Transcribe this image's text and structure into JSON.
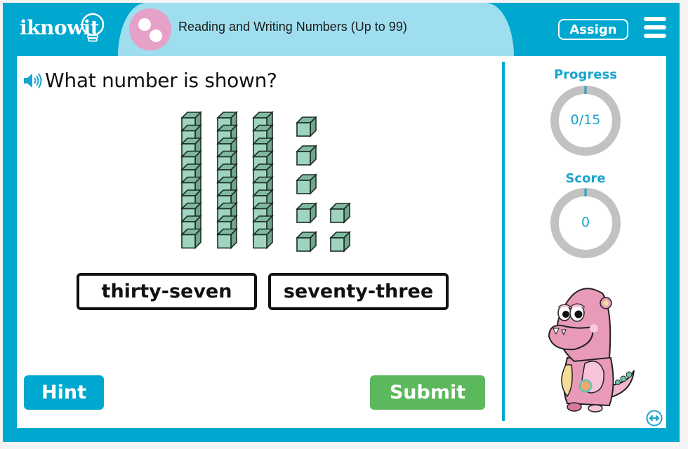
{
  "header": {
    "logo": "iknowit",
    "lesson_title": "Reading and Writing Numbers (Up to 99)",
    "assign_label": "Assign",
    "menu_icon": "hamburger-menu-icon"
  },
  "question": {
    "speaker_icon": "speaker-icon",
    "text": "What number is shown?",
    "base_ten_blocks": {
      "tens_rods": 3,
      "ones_cubes": 7
    }
  },
  "answers": [
    {
      "label": "thirty-seven"
    },
    {
      "label": "seventy-three"
    }
  ],
  "buttons": {
    "hint": "Hint",
    "submit": "Submit"
  },
  "sidebar": {
    "progress": {
      "label": "Progress",
      "value": "0/15",
      "fraction": 0
    },
    "score": {
      "label": "Score",
      "value": "0",
      "fraction": 0
    },
    "mascot": "pink-monster-mascot",
    "swap_icon": "swap-arrows-icon"
  },
  "colors": {
    "brand_blue": "#00a7cf",
    "pill_blue": "#9fdeee",
    "lesson_icon_pink": "#e6a1c8",
    "submit_green": "#5cb85c",
    "ring_gray": "#c2c2c2",
    "block_face": "#9fd5bf",
    "block_side": "#6fa68d"
  }
}
